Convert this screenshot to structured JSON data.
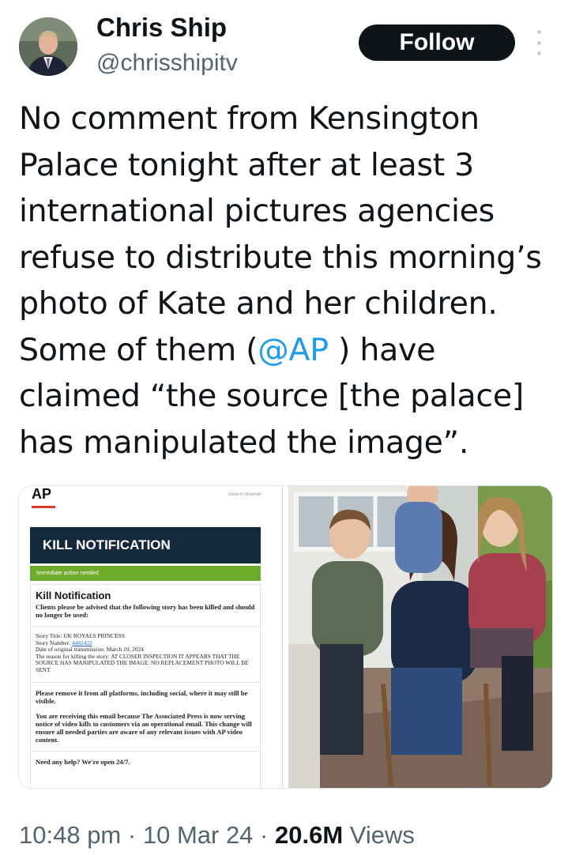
{
  "author": {
    "name": "Chris Ship",
    "handle": "@chrisshipitv"
  },
  "follow_label": "Follow",
  "tweet": {
    "text_before": "No comment from Kensington Palace tonight after at least 3 international pictures agencies refuse to distribute this morning’s photo of Kate and her children. Some of them (",
    "mention": "@AP",
    "text_after": " ) have claimed “the source [the palace] has manipulated the image”."
  },
  "attached_doc": {
    "logo": "AP",
    "view_in_browser": "View in browser",
    "banner": "KILL NOTIFICATION",
    "action_bar": "Immediate action needed",
    "heading": "Kill Notification",
    "intro": "Clients please be advised that the following story has been killed and should no longer be used:",
    "story_title": "Story Title: UK ROYALS PRINCESS",
    "story_number_label": "Story Number: ",
    "story_number": "4482422",
    "original_date": "Date of original transmission: March 10, 2024",
    "reason": "The reason for killing the story: AT CLOSER INSPECTION IT APPEARS THAT THE SOURCE HAS MANIPULATED THE IMAGE. NO REPLACEMENT PHOTO WILL BE SENT.",
    "remove": "Please remove it from all platforms, including social, where it may still be visible.",
    "receiving": "You are receiving this email because The Associated Press is now serving notice of video kills to customers via an operational email. This change will ensure all needed parties are aware of any relevant issues with AP video content.",
    "help": "Need any help? We're open 24/7."
  },
  "meta": {
    "time": "10:48 pm",
    "date": "10 Mar 24",
    "views_count": "20.6M",
    "views_label": "Views",
    "separator": "·"
  }
}
